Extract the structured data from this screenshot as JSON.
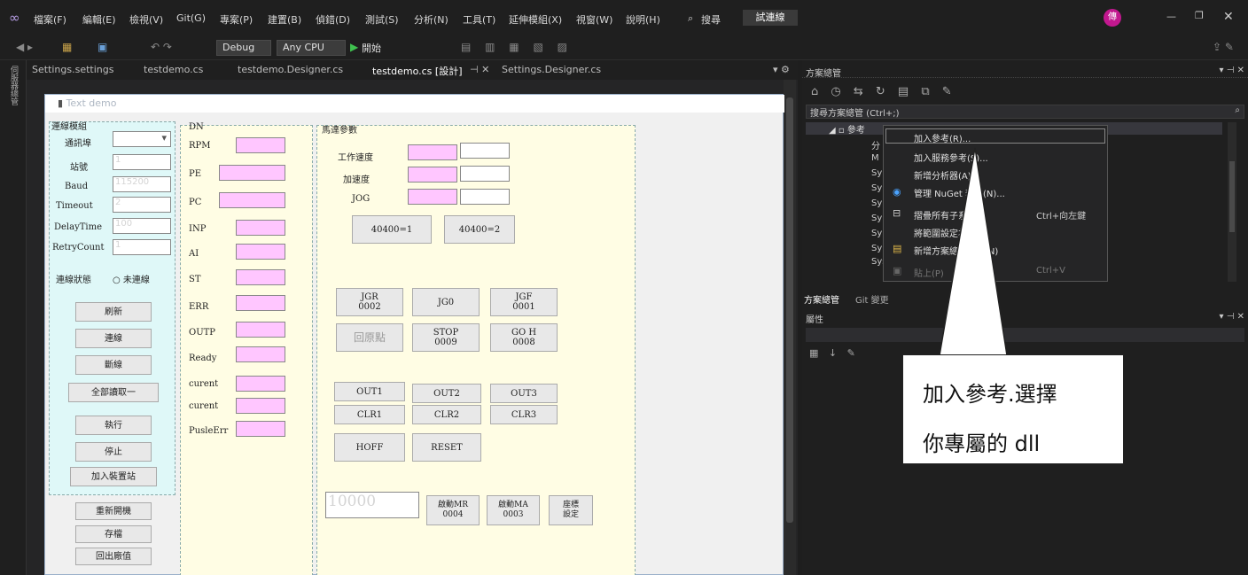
{
  "menu": {
    "items": [
      "檔案(F)",
      "編輯(E)",
      "檢視(V)",
      "Git(G)",
      "專案(P)",
      "建置(B)",
      "偵錯(D)",
      "測試(S)",
      "分析(N)",
      "工具(T)",
      "延伸模組(X)",
      "視窗(W)",
      "說明(H)"
    ],
    "search": "搜尋",
    "live_share": "試連線",
    "avatar": "傳"
  },
  "toolbar": {
    "config": "Debug",
    "platform": "Any CPU",
    "start": "開始"
  },
  "tabs": [
    "Settings.settings",
    "testdemo.cs",
    "testdemo.Designer.cs",
    "testdemo.cs [設計]",
    "Settings.Designer.cs"
  ],
  "left_strip": "伺服器總管",
  "form": {
    "title": "Text demo",
    "gb1": "連線模組",
    "gb2": "DN",
    "gb3": "馬達參數",
    "lbl_port": "通訊埠",
    "lbl_station": "站號",
    "station": "1",
    "lbl_baud": "Baud",
    "baud": "115200",
    "lbl_timeout": "Timeout",
    "timeout": "2",
    "lbl_delay": "DelayTime",
    "delay": "100",
    "lbl_retry": "RetryCount",
    "retry": "1",
    "lbl_status": "連線狀態",
    "status": "未連線",
    "btn_refresh": "刷新",
    "btn_connect": "連線",
    "btn_disconnect": "斷線",
    "btn_readall": "全部讀取一",
    "btn_exec": "執行",
    "btn_stop": "停止",
    "btn_add": "加入裝置站",
    "btn_restart": "重新開機",
    "btn_save": "存檔",
    "btn_factory": "回出廠值",
    "dn": [
      "RPM",
      "PE",
      "PC",
      "INP",
      "AI",
      "ST",
      "ERR",
      "OUTP",
      "Ready",
      "curent",
      "curent",
      "PusleErr"
    ],
    "lbl_work": "工作速度",
    "lbl_acc": "加速度",
    "lbl_jog": "JOG",
    "b40400_1": "40400=1",
    "b40400_2": "40400=2",
    "jgr": "JGR\n0002",
    "jg0": "JG0",
    "jgf": "JGF\n0001",
    "home": "回原點",
    "stop": "STOP\n0009",
    "goh": "GO H\n0008",
    "out1": "OUT1",
    "out2": "OUT2",
    "out3": "OUT3",
    "clr1": "CLR1",
    "clr2": "CLR2",
    "clr3": "CLR3",
    "hoff": "HOFF",
    "reset": "RESET",
    "pos": "10000",
    "mr": "啟動MR\n0004",
    "ma": "啟動MA\n0003",
    "coord": "座標\n設定"
  },
  "solution": {
    "title": "方案總管",
    "search": "搜尋方案總管 (Ctrl+;)",
    "refs": "參考",
    "items": [
      "分",
      "M",
      "Sy",
      "Sy",
      "Sy",
      "Sy",
      "Sy",
      "Sy",
      "System.Window"
    ],
    "tab1": "方案總管",
    "tab2": "Git 變更"
  },
  "props": {
    "title": "屬性"
  },
  "context": [
    {
      "label": "加入參考(R)...",
      "shortcut": ""
    },
    {
      "label": "加入服務參考(S)...",
      "shortcut": ""
    },
    {
      "label": "新增分析器(A)...",
      "shortcut": ""
    },
    {
      "label": "管理 NuGet 套件(N)...",
      "shortcut": ""
    },
    {
      "label": "摺疊所有子系",
      "shortcut": "Ctrl+向左鍵"
    },
    {
      "label": "將範圍設定為此(S)",
      "shortcut": ""
    },
    {
      "label": "新增方案總管檢視(N)",
      "shortcut": ""
    },
    {
      "label": "貼上(P)",
      "shortcut": "Ctrl+V"
    }
  ],
  "callout": {
    "line1": "加入參考.選擇",
    "line2": "你專屬的 dll"
  }
}
